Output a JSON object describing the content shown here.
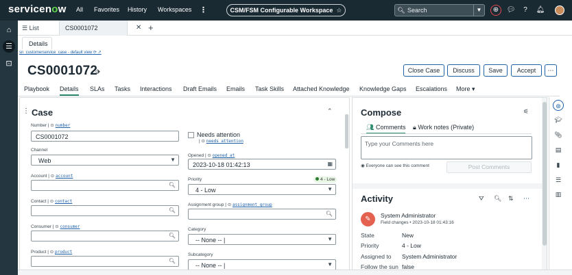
{
  "topbar": {
    "logo": "servicenow",
    "nav": [
      "All",
      "Favorites",
      "History",
      "Workspaces"
    ],
    "workspace_title": "CSM/FSM Configurable Workspace",
    "search_placeholder": "Search",
    "icons": [
      "globe-icon",
      "chat-icon",
      "help-icon",
      "bell-icon"
    ]
  },
  "tabs": {
    "list_label": "List",
    "record_tab": "CS0001072"
  },
  "subtab": "Details",
  "view_line": "sn_customerservice_case - default view",
  "record": {
    "number": "CS0001072"
  },
  "actions": [
    "Close Case",
    "Discuss",
    "Save",
    "Accept"
  ],
  "record_tabs": [
    "Playbook",
    "Details",
    "SLAs",
    "Tasks",
    "Interactions",
    "Draft Emails",
    "Emails",
    "Task Skills",
    "Attached Knowledge",
    "Knowledge Gaps",
    "Escalations",
    "More"
  ],
  "form": {
    "section_title": "Case",
    "number": {
      "label": "Number",
      "field": "number",
      "value": "CS0001072"
    },
    "channel": {
      "label": "Channel",
      "value": "Web"
    },
    "account": {
      "label": "Account",
      "field": "account",
      "value": ""
    },
    "contact": {
      "label": "Contact",
      "field": "contact",
      "value": ""
    },
    "consumer": {
      "label": "Consumer",
      "field": "consumer",
      "value": ""
    },
    "product": {
      "label": "Product",
      "field": "product",
      "value": ""
    },
    "needs_attention": {
      "label": "Needs attention",
      "field": "needs_attention"
    },
    "opened": {
      "label": "Opened",
      "field": "opened_at",
      "value": "2023-10-18 01:42:13"
    },
    "priority": {
      "label": "Priority",
      "value": "4 - Low",
      "badge": "4 - Low"
    },
    "assignment_group": {
      "label": "Assignment group",
      "field": "assignment_group",
      "value": ""
    },
    "category": {
      "label": "Category",
      "value": "-- None -- |"
    },
    "subcategory": {
      "label": "Subcategory",
      "value": "-- None -- |"
    }
  },
  "compose": {
    "title": "Compose",
    "tab_comments": "Comments",
    "tab_worknotes": "Work notes (Private)",
    "placeholder": "Type your Comments here",
    "visibility": "Everyone can see this comment",
    "post_button": "Post Comments"
  },
  "activity": {
    "title": "Activity",
    "user": "System Administrator",
    "meta": "Field changes • 2023-10-18 01:43:16",
    "rows": [
      {
        "k": "State",
        "v": "New"
      },
      {
        "k": "Priority",
        "v": "4 - Low"
      },
      {
        "k": "Assigned to",
        "v": "System Administrator"
      },
      {
        "k": "Follow the sun",
        "v": "false"
      }
    ]
  },
  "colors": {
    "topbar": "#1a2a33",
    "rail": "#243640",
    "accent": "#2d8a6e",
    "link": "#1b5fa8",
    "avatar": "#e4614f"
  }
}
